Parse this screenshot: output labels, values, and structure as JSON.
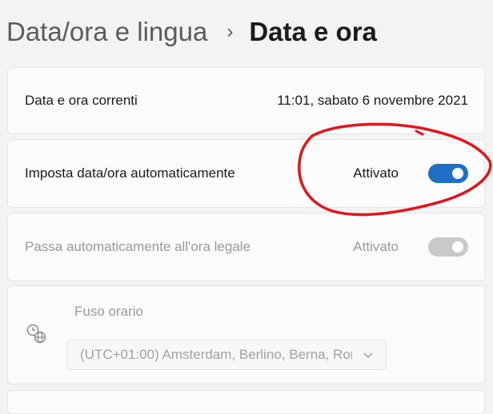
{
  "breadcrumb": {
    "parent": "Data/ora e lingua",
    "separator": "›",
    "current": "Data e ora"
  },
  "current_datetime": {
    "label": "Data e ora correnti",
    "value": "11:01, sabato 6 novembre 2021"
  },
  "auto_time": {
    "label": "Imposta data/ora automaticamente",
    "state": "Attivato",
    "on": true
  },
  "auto_dst": {
    "label": "Passa automaticamente all'ora legale",
    "state": "Attivato",
    "on": true,
    "disabled": true
  },
  "timezone": {
    "label": "Fuso orario",
    "selected": "(UTC+01:00) Amsterdam, Berlino, Berna, Ror",
    "disabled": true
  },
  "colors": {
    "accent": "#1f6fc7",
    "annotation": "#e0161c"
  }
}
